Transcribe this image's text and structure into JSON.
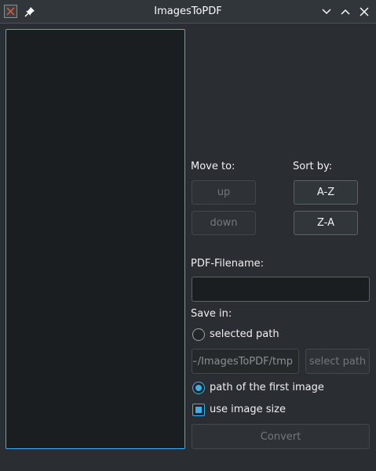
{
  "window": {
    "title": "ImagesToPDF"
  },
  "move": {
    "label": "Move to:",
    "up_label": "up",
    "down_label": "down"
  },
  "sort": {
    "label": "Sort by:",
    "az_label": "A-Z",
    "za_label": "Z-A"
  },
  "pdf": {
    "filename_label": "PDF-Filename:",
    "filename_value": ""
  },
  "save": {
    "label": "Save in:",
    "selected_path_label": "selected path",
    "path_value": "~/ImagesToPDF/tmp",
    "select_path_button": "select path",
    "first_image_label": "path of the first image",
    "selected_option": "path of the first image"
  },
  "options": {
    "use_image_size_label": "use image size",
    "use_image_size_checked": true
  },
  "convert_label": "Convert",
  "colors": {
    "accent": "#3daee9",
    "window_bg": "#2a2e32",
    "list_bg": "#1b1e20"
  },
  "icons": [
    "app-icon",
    "pin-icon",
    "minimize-icon",
    "maximize-icon",
    "close-icon"
  ]
}
